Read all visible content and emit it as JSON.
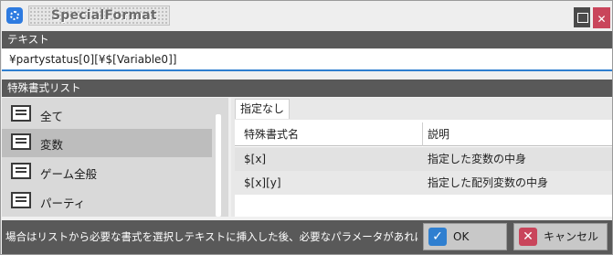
{
  "window": {
    "title": "SpecialFormat"
  },
  "text_section": {
    "header": "テキスト",
    "value": "¥partystatus[0][¥$[Variable0]]"
  },
  "list_section": {
    "header": "特殊書式リスト",
    "items": [
      {
        "label": "全て",
        "icon": "monitor-icon"
      },
      {
        "label": "変数",
        "icon": "monitor-icon",
        "selected": true
      },
      {
        "label": "ゲーム全般",
        "icon": "monitor-icon"
      },
      {
        "label": "パーティ",
        "icon": "monitor-icon"
      }
    ]
  },
  "detail": {
    "tab": "指定なし",
    "columns": [
      "特殊書式名",
      "説明"
    ],
    "rows": [
      [
        "$[x]",
        "指定した変数の中身"
      ],
      [
        "$[x][y]",
        "指定した配列変数の中身"
      ]
    ]
  },
  "footer": {
    "hint": "場合はリストから必要な書式を選択しテキストに挿入した後、必要なパラメータがあれば",
    "ok_label": "OK",
    "cancel_label": "キャンセル"
  }
}
